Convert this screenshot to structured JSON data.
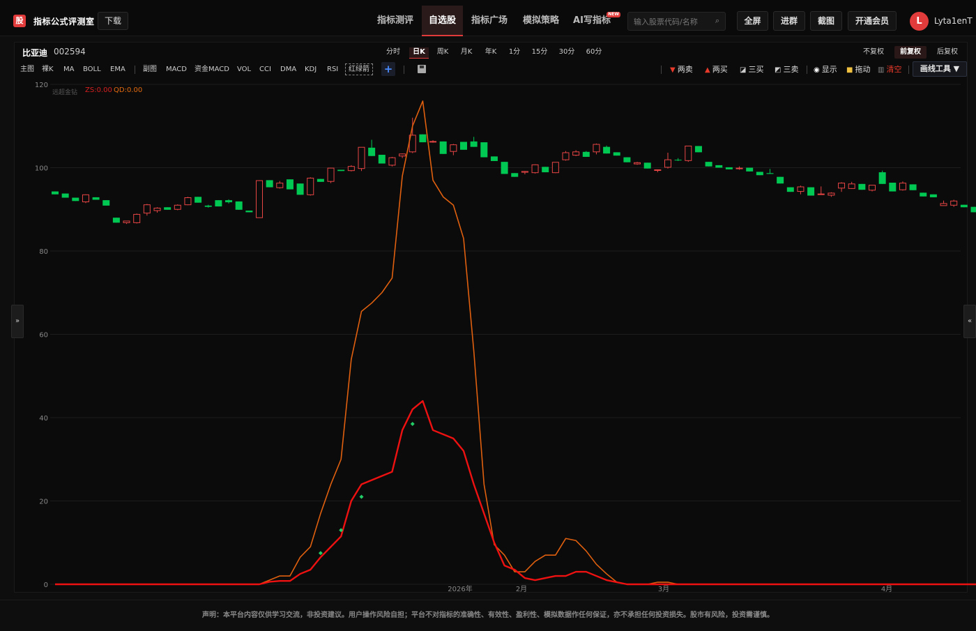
{
  "header": {
    "logo_mark": "股",
    "logo_text": "指标公式评测室",
    "download": "下载",
    "nav": [
      "指标测评",
      "自选股",
      "指标广场",
      "模拟策略",
      "AI写指标"
    ],
    "nav_active": 1,
    "new_badge": "NEW",
    "search_placeholder": "输入股票代码/名称",
    "buttons": [
      "全屏",
      "进群",
      "截图",
      "开通会员"
    ],
    "avatar_letter": "L",
    "username": "Lyta1enT"
  },
  "stock": {
    "name": "比亚迪",
    "code": "002594"
  },
  "periods": [
    "分时",
    "日K",
    "周K",
    "月K",
    "年K",
    "1分",
    "15分",
    "30分",
    "60分"
  ],
  "period_active": 1,
  "fq": [
    "不复权",
    "前复权",
    "后复权"
  ],
  "fq_active": 1,
  "indicators_main": [
    "主图",
    "裸K",
    "MA",
    "BOLL",
    "EMA"
  ],
  "indicators_sub": [
    "副图",
    "MACD",
    "资金MACD",
    "VOL",
    "CCI",
    "DMA",
    "KDJ",
    "RSI",
    "红绿箭"
  ],
  "tools": {
    "sell2": "两卖",
    "buy2": "两买",
    "buy3": "三买",
    "sell3": "三卖",
    "show": "显示",
    "drag": "拖动",
    "clear": "清空",
    "draw": "画线工具 ▼",
    "plus": "+"
  },
  "legend": {
    "name": "远超金钻",
    "zs": "ZS:0.00",
    "qd": "QD:0.00"
  },
  "side": {
    "left": "»",
    "right": "«"
  },
  "footer": "声明：本平台内容仅供学习交流，非投资建议。用户操作风险自担；平台不对指标的准确性、有效性、盈利性、模拟数据作任何保证，亦不承担任何投资损失。股市有风险，投资需谨慎。",
  "colors": {
    "up": "#e84545",
    "down": "#00c853",
    "zs": "#ee1111",
    "qd": "#e0600f",
    "accent": "#e23b3b"
  },
  "chart_data": {
    "type": "candlestick",
    "ylim": [
      0,
      120
    ],
    "yticks": [
      0,
      20,
      40,
      60,
      80,
      100,
      120
    ],
    "x_labels": [
      "2026年",
      "2月",
      "3月",
      "4月"
    ],
    "candles": [
      [
        94.3,
        94.3,
        93.6,
        93.6
      ],
      [
        93.8,
        93.8,
        92.8,
        92.8
      ],
      [
        92.8,
        92.8,
        92.0,
        92.0
      ],
      [
        91.8,
        93.6,
        91.5,
        93.5
      ],
      [
        92.9,
        92.9,
        92.3,
        92.3
      ],
      [
        92.2,
        92.2,
        90.9,
        90.9
      ],
      [
        88.0,
        88.0,
        86.8,
        86.8
      ],
      [
        86.8,
        87.2,
        86.5,
        87.2
      ],
      [
        86.8,
        89.0,
        86.6,
        88.8
      ],
      [
        89.1,
        91.3,
        88.5,
        91.1
      ],
      [
        89.7,
        90.5,
        89.2,
        90.3
      ],
      [
        90.5,
        90.5,
        89.9,
        89.9
      ],
      [
        90.0,
        91.2,
        89.8,
        91.0
      ],
      [
        91.1,
        93.0,
        91.0,
        92.8
      ],
      [
        93.0,
        93.0,
        91.6,
        91.6
      ],
      [
        90.9,
        91.1,
        90.4,
        90.6
      ],
      [
        92.2,
        92.2,
        90.7,
        90.7
      ],
      [
        92.2,
        92.4,
        91.4,
        91.7
      ],
      [
        91.9,
        91.9,
        89.9,
        89.9
      ],
      [
        89.7,
        89.7,
        89.3,
        89.3
      ],
      [
        88.0,
        97.0,
        88.0,
        96.9
      ],
      [
        97.0,
        97.0,
        95.3,
        95.3
      ],
      [
        95.2,
        96.8,
        95.0,
        96.3
      ],
      [
        97.2,
        97.2,
        94.8,
        94.8
      ],
      [
        96.2,
        96.2,
        93.5,
        93.5
      ],
      [
        93.5,
        97.7,
        93.3,
        97.5
      ],
      [
        97.3,
        97.3,
        96.6,
        96.6
      ],
      [
        96.7,
        100.0,
        96.3,
        99.9
      ],
      [
        99.5,
        99.5,
        99.2,
        99.2
      ],
      [
        99.3,
        100.6,
        99.1,
        100.3
      ],
      [
        99.8,
        104.9,
        99.2,
        104.9
      ],
      [
        104.8,
        106.7,
        102.8,
        102.8
      ],
      [
        103.1,
        103.1,
        101.0,
        101.0
      ],
      [
        100.6,
        102.6,
        100.3,
        102.4
      ],
      [
        102.8,
        103.4,
        102.3,
        103.3
      ],
      [
        103.8,
        112.0,
        103.5,
        107.8
      ],
      [
        108.0,
        108.0,
        106.1,
        106.1
      ],
      [
        106.2,
        106.6,
        106.0,
        106.3
      ],
      [
        106.3,
        106.3,
        103.3,
        103.3
      ],
      [
        103.9,
        105.7,
        103.0,
        105.5
      ],
      [
        106.2,
        106.2,
        104.3,
        104.3
      ],
      [
        106.3,
        107.4,
        105.0,
        105.0
      ],
      [
        106.1,
        106.1,
        102.5,
        102.5
      ],
      [
        102.7,
        102.7,
        101.6,
        101.6
      ],
      [
        101.4,
        101.4,
        98.5,
        98.5
      ],
      [
        98.7,
        98.7,
        97.8,
        97.8
      ],
      [
        98.9,
        99.2,
        98.4,
        99.1
      ],
      [
        98.8,
        100.8,
        98.6,
        100.7
      ],
      [
        100.2,
        100.2,
        98.9,
        98.9
      ],
      [
        98.8,
        101.3,
        98.7,
        101.3
      ],
      [
        101.9,
        104.0,
        101.7,
        103.6
      ],
      [
        103.0,
        104.2,
        102.8,
        103.8
      ],
      [
        103.8,
        104.0,
        102.6,
        102.6
      ],
      [
        103.8,
        105.8,
        103.2,
        105.6
      ],
      [
        105.0,
        105.3,
        103.4,
        103.4
      ],
      [
        103.7,
        103.7,
        102.9,
        102.9
      ],
      [
        102.5,
        102.5,
        101.3,
        101.3
      ],
      [
        100.9,
        101.4,
        100.7,
        101.2
      ],
      [
        101.2,
        101.2,
        99.8,
        99.8
      ],
      [
        99.5,
        99.6,
        98.9,
        99.5
      ],
      [
        100.1,
        103.6,
        99.8,
        101.9
      ],
      [
        101.9,
        102.3,
        101.6,
        101.8
      ],
      [
        101.7,
        105.2,
        101.4,
        105.2
      ],
      [
        105.2,
        105.2,
        103.7,
        103.7
      ],
      [
        101.4,
        101.4,
        100.3,
        100.3
      ],
      [
        100.6,
        100.6,
        100.0,
        100.0
      ],
      [
        100.1,
        100.1,
        99.6,
        99.6
      ],
      [
        99.9,
        100.3,
        99.5,
        99.9
      ],
      [
        100.0,
        100.0,
        99.1,
        99.1
      ],
      [
        99.0,
        99.0,
        98.2,
        98.2
      ],
      [
        98.7,
        99.7,
        98.5,
        98.5
      ],
      [
        97.8,
        97.8,
        96.2,
        96.2
      ],
      [
        95.3,
        95.3,
        94.2,
        94.2
      ],
      [
        94.3,
        95.7,
        93.6,
        95.4
      ],
      [
        95.3,
        95.3,
        93.3,
        93.3
      ],
      [
        93.7,
        95.5,
        93.5,
        93.7
      ],
      [
        93.4,
        94.1,
        93.0,
        93.9
      ],
      [
        95.1,
        96.5,
        94.2,
        96.3
      ],
      [
        95.0,
        96.6,
        94.9,
        96.1
      ],
      [
        96.1,
        96.1,
        94.7,
        94.7
      ],
      [
        94.6,
        95.8,
        94.3,
        95.8
      ],
      [
        98.9,
        99.3,
        96.1,
        96.1
      ],
      [
        96.4,
        96.4,
        94.3,
        94.3
      ],
      [
        94.7,
        96.7,
        94.5,
        96.3
      ],
      [
        96.0,
        96.0,
        94.6,
        94.6
      ],
      [
        94.0,
        94.0,
        93.1,
        93.1
      ],
      [
        93.6,
        93.6,
        92.9,
        92.9
      ],
      [
        90.9,
        92.1,
        90.9,
        91.4
      ],
      [
        91.0,
        92.3,
        90.6,
        92.0
      ],
      [
        91.1,
        91.1,
        90.5,
        90.5
      ],
      [
        90.6,
        90.6,
        89.3,
        89.3
      ]
    ],
    "series": [
      {
        "name": "QD",
        "values": [
          0,
          0,
          0,
          0,
          0,
          0,
          0,
          0,
          0,
          0,
          0,
          0,
          0,
          0,
          0,
          0,
          0,
          0,
          0,
          0,
          0,
          1,
          2,
          2,
          6.5,
          9,
          17,
          24,
          30,
          54,
          65.5,
          67.5,
          70,
          73.5,
          98,
          110,
          116,
          97,
          93,
          91,
          83,
          56,
          24,
          9.5,
          7,
          3,
          3,
          5.5,
          7,
          7,
          11,
          10.5,
          8,
          4.8,
          2.5,
          0.5,
          0,
          0,
          0,
          0.5,
          0.5,
          0,
          0,
          0,
          0,
          0,
          0,
          0,
          0,
          0,
          0,
          0,
          0,
          0,
          0,
          0,
          0,
          0,
          0,
          0,
          0,
          0,
          0,
          0,
          0,
          0,
          0,
          0,
          0,
          0,
          0,
          0,
          0
        ]
      },
      {
        "name": "ZS",
        "values": [
          0,
          0,
          0,
          0,
          0,
          0,
          0,
          0,
          0,
          0,
          0,
          0,
          0,
          0,
          0,
          0,
          0,
          0,
          0,
          0,
          0,
          0.6,
          0.8,
          0.8,
          2.5,
          3.5,
          6.5,
          9,
          11.5,
          20,
          24,
          25,
          26,
          27,
          37,
          42,
          44,
          37,
          36,
          35,
          32,
          24,
          17,
          10,
          4.5,
          3.5,
          1.5,
          1,
          1.5,
          2,
          2,
          3,
          3,
          2,
          1,
          0.5,
          0,
          0,
          0,
          0,
          0,
          0,
          0,
          0,
          0,
          0,
          0,
          0,
          0,
          0,
          0,
          0,
          0,
          0,
          0,
          0,
          0,
          0,
          0,
          0,
          0,
          0,
          0,
          0,
          0,
          0,
          0,
          0,
          0,
          0,
          0,
          0,
          0
        ]
      }
    ],
    "markers": [
      {
        "index": 26,
        "value": 7.5
      },
      {
        "index": 28,
        "value": 13
      },
      {
        "index": 30,
        "value": 21
      },
      {
        "index": 35,
        "value": 38.5
      }
    ]
  }
}
